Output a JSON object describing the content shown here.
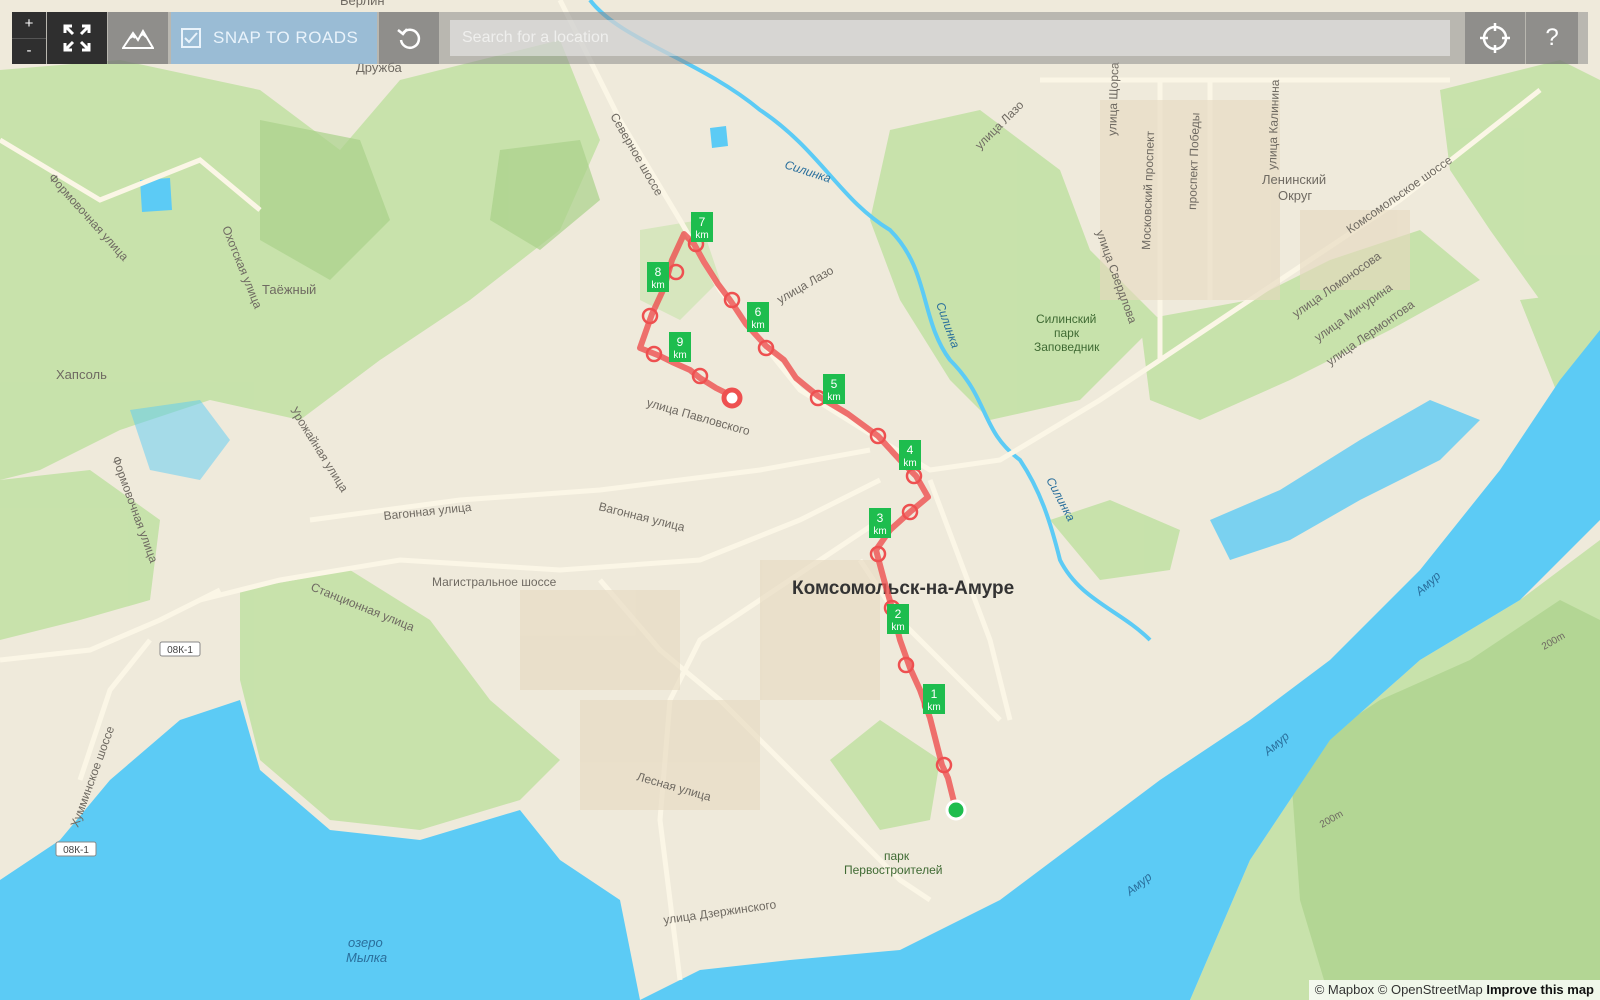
{
  "toolbar": {
    "zoom_in": "+",
    "zoom_out": "-",
    "snap_label": "SNAP TO ROADS",
    "snap_checked": true,
    "search_placeholder": "Search for a location",
    "help": "?"
  },
  "icons": {
    "fullscreen": "fullscreen-icon",
    "terrain": "mountain-icon",
    "undo": "undo-icon",
    "locate": "crosshair-icon",
    "check": "check-icon"
  },
  "map": {
    "city_label": "Комсомольск-на-Амуре",
    "park_label_1": "Силинский",
    "park_label_2": "парк",
    "park_label_3": "Заповедник",
    "park2_label_1": "парк",
    "park2_label_2": "Первостроителей",
    "district_label_1": "Ленинский",
    "district_label_2": "Округ",
    "village_taezhny": "Таёжный",
    "village_khapsol": "Хапсоль",
    "village_druzhba": "Дружба",
    "village_berlin": "Берлин",
    "lake_label_1": "озеро",
    "lake_label_2": "Мылка",
    "river_silinka": "Силинка",
    "river_amur": "Амур",
    "road_badge": "08К-1",
    "elevation_label": "200m",
    "streets": {
      "pavlovskogo": "улица Павловского",
      "vagonnaya": "Вагонная улица",
      "magistralnoe": "Магистральное шоссе",
      "stantsionnaya": "Станционная улица",
      "lesnaya": "Лесная улица",
      "dzerzhinskogo": "улица Дзержинского",
      "lazo": "улица Лазо",
      "severnoe": "Северное шоссе",
      "okhotskaya": "Охотская улица",
      "formovochnaya": "Формовочная улица",
      "urozhaynaya": "Урожайная улица",
      "khumminskoe": "Хумминское шоссе",
      "komsomolskoe": "Комсомольское шоссе",
      "lomonosova": "улица Ломоносова",
      "michurina": "улица Мичурина",
      "lermontova": "улица Лермонтова",
      "sverdlova": "улица Свердлова",
      "moskovsky": "Московский проспект",
      "pobedy": "проспект Победы",
      "kalinina": "улица Калинина",
      "shorsa": "улица Щорса"
    }
  },
  "route": {
    "km_unit": "km",
    "markers": [
      "1",
      "2",
      "3",
      "4",
      "5",
      "6",
      "7",
      "8",
      "9"
    ]
  },
  "attribution": {
    "mapbox": "© Mapbox",
    "osm": "© OpenStreetMap",
    "improve": "Improve this map"
  },
  "colors": {
    "water": "#5ccbf5",
    "land": "#f1ecdc",
    "green": "#b7dc9b",
    "route": "#ee5050",
    "marker": "#1ebd4e"
  }
}
